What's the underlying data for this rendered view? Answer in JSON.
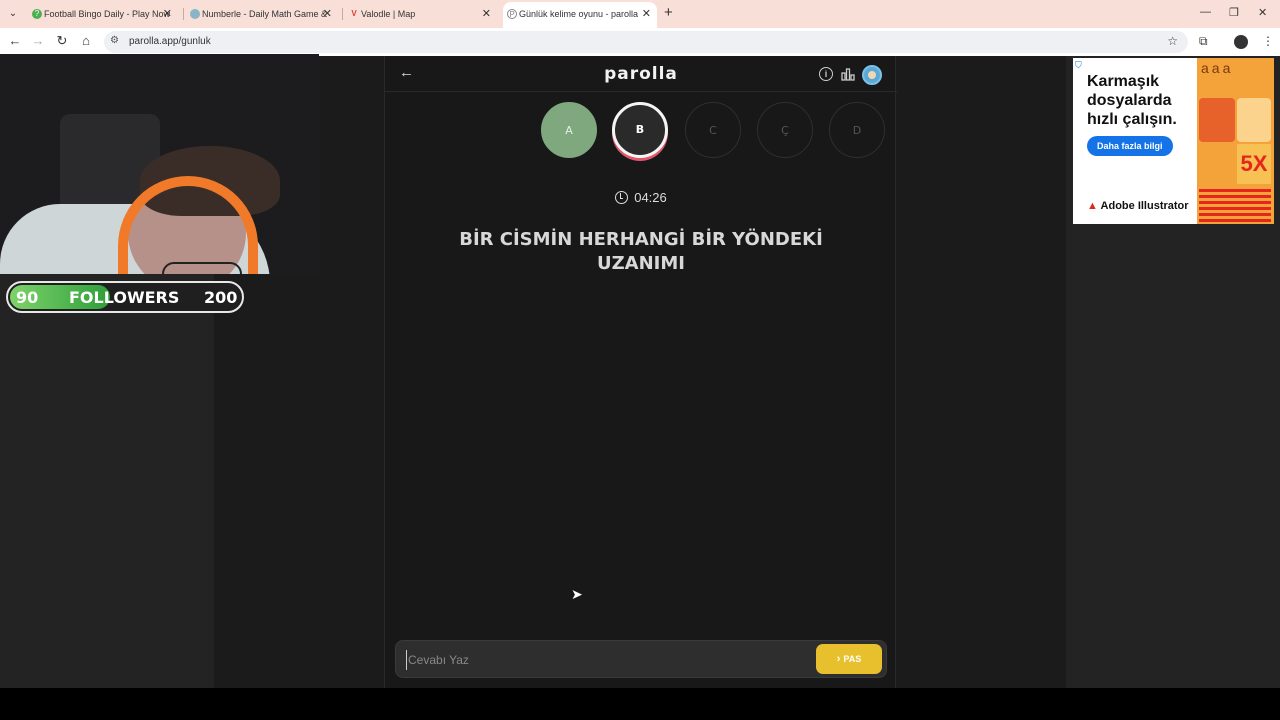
{
  "browser": {
    "tabs": [
      {
        "title": "Football Bingo Daily - Play Now",
        "active": false,
        "favicon_color": "#4caf50"
      },
      {
        "title": "Numberle - Daily Math Game &",
        "active": false,
        "favicon_color": "#8ab4c8"
      },
      {
        "title": "Valodle | Map",
        "active": false,
        "favicon_color": "#e53935"
      },
      {
        "title": "Günlük kelime oyunu - parolla",
        "active": true,
        "favicon_color": "#888888"
      }
    ],
    "url": "parolla.app/gunluk"
  },
  "app": {
    "brand": "parolla",
    "letters": [
      {
        "label": "A",
        "state": "done"
      },
      {
        "label": "B",
        "state": "current"
      },
      {
        "label": "C",
        "state": "pending"
      },
      {
        "label": "Ç",
        "state": "pending"
      },
      {
        "label": "D",
        "state": "pending"
      }
    ],
    "timer": "04:26",
    "question": "BİR CİSMİN HERHANGİ BİR YÖNDEKİ UZANIMI",
    "answer_placeholder": "Cevabı Yaz",
    "pass_label": "PAS"
  },
  "overlay": {
    "followers_current": "90",
    "followers_label": "FOLLOWERS",
    "followers_goal": "200"
  },
  "ad": {
    "headline": "Karmaşık dosyalarda hızlı çalışın.",
    "button": "Daha fazla bilgi",
    "brand": "Adobe Illustrator",
    "art_letters": "aaa",
    "art_big": "5X"
  },
  "colors": {
    "accent_done": "#7fa87f",
    "accent_pass": "#e8c02e",
    "current_ring": "#e0586b"
  }
}
